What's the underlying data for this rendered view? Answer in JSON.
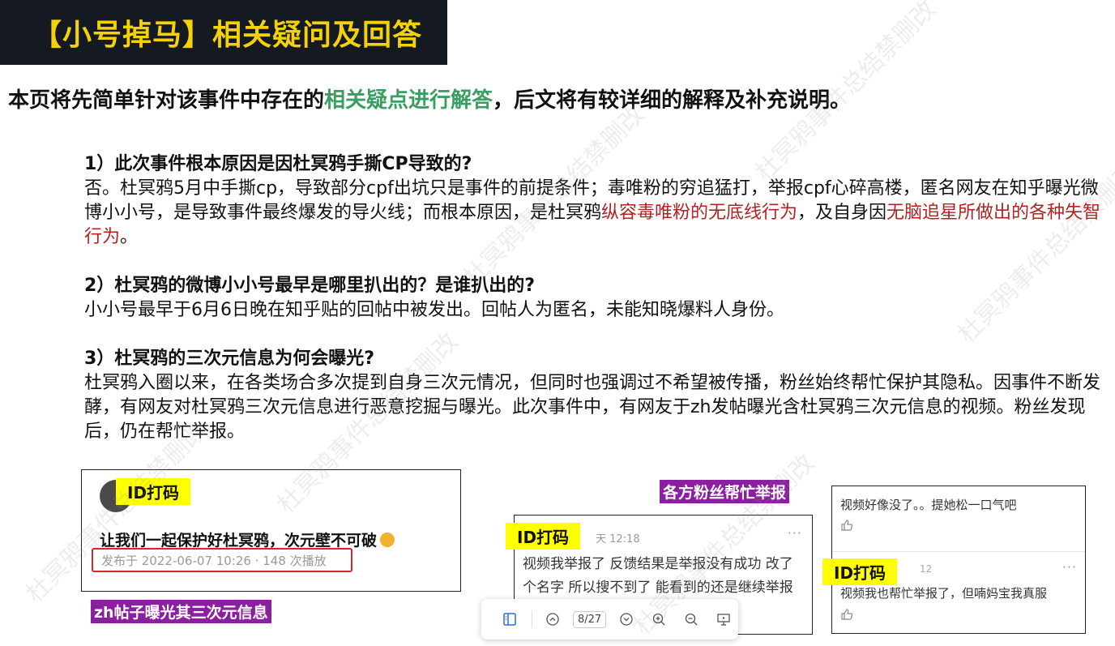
{
  "header": {
    "title": "【小号掉马】相关疑问及回答"
  },
  "intro": {
    "part1": "本页将先简单针对该事件中存在的",
    "highlight": "相关疑点进行解答",
    "part2": "，后文将有较详细的解释及补充说明。"
  },
  "qa": [
    {
      "question": "1）此次事件根本原因是因杜冥鸦手撕CP导致的?",
      "answer_part1": "否。杜冥鸦5月中手撕cp，导致部分cpf出坑只是事件的前提条件；毒唯粉的穷追猛打，举报cpf心碎高楼，匿名网友在知乎曝光微博小小号，是导致事件最终爆发的导火线；而根本原因，是杜冥鸦",
      "answer_red1": "纵容毒唯粉的无底线行为",
      "answer_part2": "，及自身因",
      "answer_red2": "无脑追星所做出的各种失智行为",
      "answer_part3": "。"
    },
    {
      "question": "2）杜冥鸦的微博小小号最早是哪里扒出的？是谁扒出的?",
      "answer": "小小号最早于6月6日晚在知乎贴的回帖中被发出。回帖人为匿名，未能知晓爆料人身份。"
    },
    {
      "question": "3）杜冥鸦的三次元信息为何会曝光?",
      "answer": "杜冥鸦入圈以来，在各类场合多次提到自身三次元情况，但同时也强调过不希望被传播，粉丝始终帮忙保护其隐私。因事件不断发酵，有网友对杜冥鸦三次元信息进行恶意挖掘与曝光。此次事件中，有网友于zh发帖曝光含杜冥鸦三次元信息的视频。粉丝发现后，仍在帮忙举报。"
    }
  ],
  "screenshot1": {
    "tag": "ID打码",
    "post_text": "让我们一起保护好杜冥鸦，次元壁不可破",
    "meta": "发布于 2022-06-07 10:26 · 148 次播放",
    "caption": "zh帖子曝光其三次元信息"
  },
  "screenshot2": {
    "tag": "ID打码",
    "time": "天 12:18",
    "dots": "···",
    "comment": "视频我举报了 反馈结果是举报没有成功 改了个名字 所以搜不到了 能看到的还是继续举报",
    "top_label": "各方粉丝帮忙举报"
  },
  "screenshot3": {
    "comment1": "视频好像没了。。提她松一口气吧",
    "tag": "ID打码",
    "time": "12",
    "dots": "···",
    "comment2": "视频我也帮忙举报了，但喃妈宝我真服"
  },
  "toolbar": {
    "page_indicator": "8/27"
  },
  "watermark": {
    "text": "杜冥鸦事件总结禁删改"
  }
}
